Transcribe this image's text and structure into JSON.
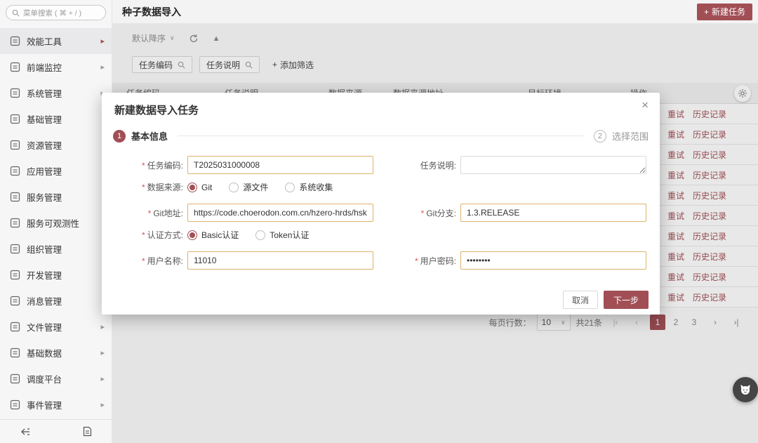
{
  "colors": {
    "accent": "#a14f55",
    "amber": "#ddb36a"
  },
  "icons": {
    "close": "×",
    "plus": "+",
    "caret_down": "∨",
    "caret_up": "▲",
    "arrow_right": "▸"
  },
  "sidebar": {
    "search_placeholder": "菜单搜索 ( ⌘ + / )",
    "items": [
      {
        "name": "efficiency-tools",
        "label": "效能工具",
        "arrow": true,
        "selected": true
      },
      {
        "name": "frontend-monitoring",
        "label": "前端监控",
        "arrow": true,
        "selected": false
      },
      {
        "name": "system-management",
        "label": "系统管理",
        "arrow": true,
        "selected": false
      },
      {
        "name": "basic-management",
        "label": "基础管理",
        "arrow": false,
        "selected": false
      },
      {
        "name": "resource-management",
        "label": "资源管理",
        "arrow": false,
        "selected": false
      },
      {
        "name": "application-management",
        "label": "应用管理",
        "arrow": false,
        "selected": false
      },
      {
        "name": "service-management",
        "label": "服务管理",
        "arrow": false,
        "selected": false
      },
      {
        "name": "service-observability",
        "label": "服务可观测性",
        "arrow": false,
        "selected": false
      },
      {
        "name": "organization-management",
        "label": "组织管理",
        "arrow": false,
        "selected": false
      },
      {
        "name": "development-management",
        "label": "开发管理",
        "arrow": false,
        "selected": false
      },
      {
        "name": "message-management",
        "label": "消息管理",
        "arrow": false,
        "selected": false
      },
      {
        "name": "file-management",
        "label": "文件管理",
        "arrow": true,
        "selected": false
      },
      {
        "name": "basic-data",
        "label": "基础数据",
        "arrow": true,
        "selected": false
      },
      {
        "name": "scheduling-platform",
        "label": "调度平台",
        "arrow": true,
        "selected": false
      },
      {
        "name": "event-management",
        "label": "事件管理",
        "arrow": true,
        "selected": false
      }
    ]
  },
  "header": {
    "title": "种子数据导入",
    "new_task_label": "新建任务"
  },
  "toolbar": {
    "sort_label": "默认降序",
    "filter_chips": [
      "任务编码",
      "任务说明"
    ],
    "add_filter_label": "添加筛选"
  },
  "table": {
    "headers": [
      "任务编码",
      "任务说明",
      "数据来源",
      "数据来源地址",
      "目标环境",
      "操作"
    ],
    "row_count": 10,
    "row_actions": [
      "重试",
      "历史记录"
    ]
  },
  "pagination": {
    "rows_per_page_label": "每页行数：",
    "rows_per_page": "10",
    "total": "共21条",
    "pages": [
      "1",
      "2",
      "3"
    ],
    "active_page": "1",
    "icons": {
      "first": "|‹",
      "prev": "‹",
      "next": "›",
      "last": "›|"
    }
  },
  "modal": {
    "title": "新建数据导入任务",
    "required_mark": "*",
    "steps": [
      {
        "num": "1",
        "label": "基本信息"
      },
      {
        "num": "2",
        "label": "选择范围"
      }
    ],
    "fields": {
      "task_code": {
        "label": "任务编码:",
        "value": "T2025031000008"
      },
      "task_desc": {
        "label": "任务说明:",
        "value": ""
      },
      "data_source": {
        "label": "数据来源:",
        "options": [
          "Git",
          "源文件",
          "系统收集"
        ],
        "selected": "Git"
      },
      "git_url": {
        "label": "Git地址:",
        "value": "https://code.choerodon.com.cn/hzero-hrds/hskp-re"
      },
      "git_branch": {
        "label": "Git分支:",
        "value": "1.3.RELEASE"
      },
      "auth_type": {
        "label": "认证方式:",
        "options": [
          "Basic认证",
          "Token认证"
        ],
        "selected": "Basic认证"
      },
      "username": {
        "label": "用户名称:",
        "value": "11010"
      },
      "password": {
        "label": "用户密码:",
        "value": "••••••••"
      }
    },
    "cancel_button": "取消",
    "next_button": "下一步"
  }
}
